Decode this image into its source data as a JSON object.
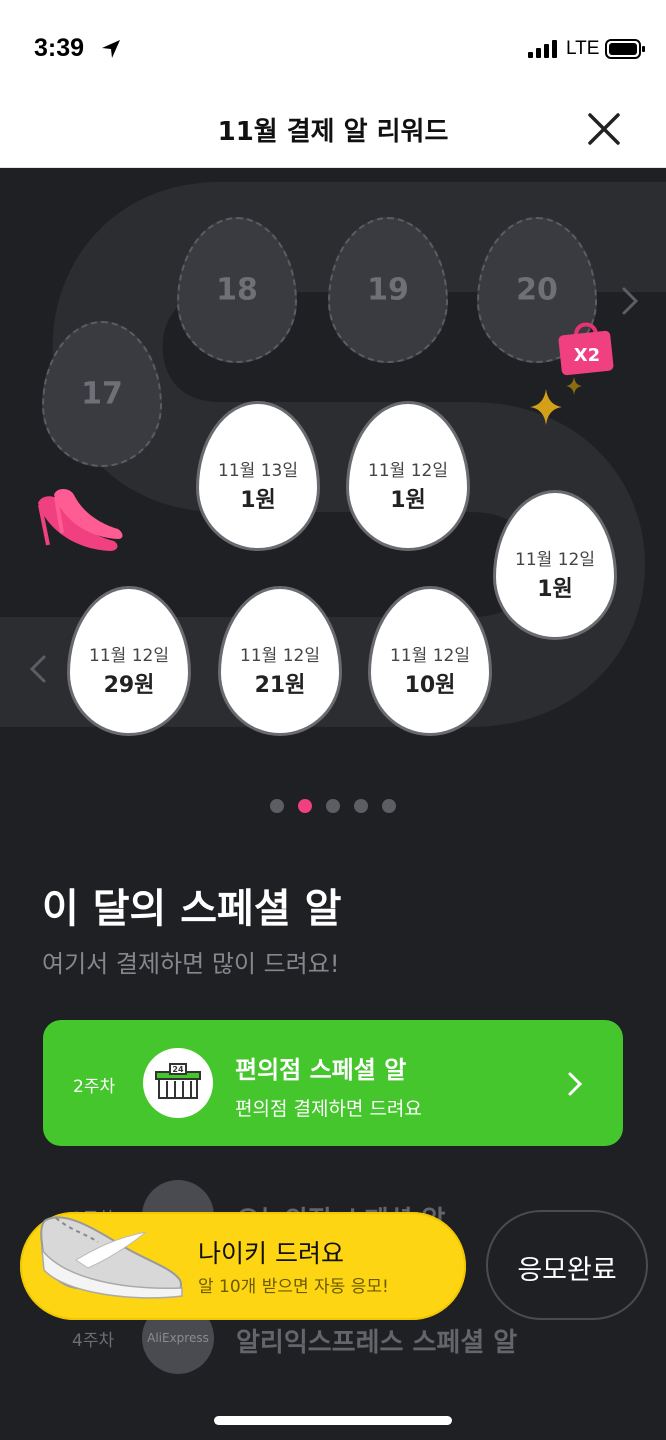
{
  "status": {
    "time": "3:39",
    "network": "LTE"
  },
  "header": {
    "title": "11월 결제 알 리워드"
  },
  "eggs": {
    "empty": [
      "17",
      "18",
      "19",
      "20"
    ],
    "collected": [
      {
        "date": "11월 13일",
        "amount": "1원"
      },
      {
        "date": "11월 12일",
        "amount": "1원"
      },
      {
        "date": "11월 12일",
        "amount": "1원"
      },
      {
        "date": "11월 12일",
        "amount": "29원"
      },
      {
        "date": "11월 12일",
        "amount": "21원"
      },
      {
        "date": "11월 12일",
        "amount": "10원"
      }
    ],
    "multiplier": "X2"
  },
  "pager": {
    "count": 5,
    "active_index": 1
  },
  "special": {
    "title": "이 달의 스페셜 알",
    "subtitle": "여기서 결제하면 많이 드려요!",
    "card": {
      "week": "2주차",
      "icon_text": "24",
      "title": "편의점 스페셜 알",
      "desc": "편의점 결제하면 드려요"
    },
    "rows": [
      {
        "week": "3주차",
        "label": "오늘의집 스페셜 알"
      },
      {
        "week": "4주차",
        "label": "알리익스프레스 스페셜 알",
        "logo_text": "AliExpress"
      }
    ]
  },
  "promo": {
    "title": "나이키 드려요",
    "desc": "알 10개 받으면 자동 응모!",
    "button": "응모완료"
  },
  "colors": {
    "accent_green": "#44c62c",
    "accent_yellow": "#fdd512",
    "accent_pink": "#f0407f",
    "background": "#1f2024"
  }
}
